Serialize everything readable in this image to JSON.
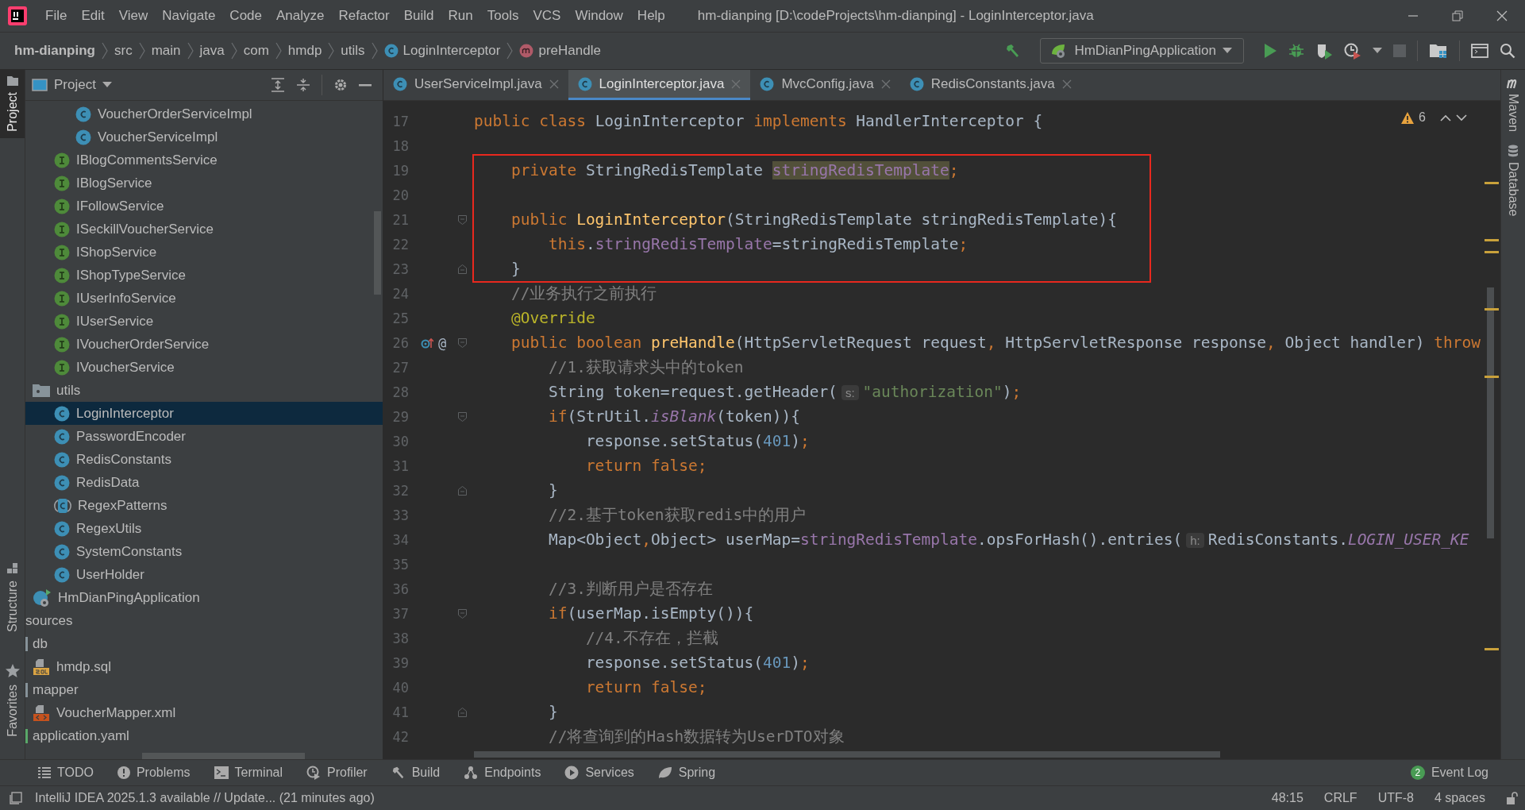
{
  "window": {
    "title": "hm-dianping [D:\\codeProjects\\hm-dianping] - LoginInterceptor.java"
  },
  "menu": [
    "File",
    "Edit",
    "View",
    "Navigate",
    "Code",
    "Analyze",
    "Refactor",
    "Build",
    "Run",
    "Tools",
    "VCS",
    "Window",
    "Help"
  ],
  "breadcrumb": [
    {
      "label": "hm-dianping",
      "kind": "project"
    },
    {
      "label": "src",
      "kind": "folder"
    },
    {
      "label": "main",
      "kind": "folder"
    },
    {
      "label": "java",
      "kind": "folder"
    },
    {
      "label": "com",
      "kind": "folder"
    },
    {
      "label": "hmdp",
      "kind": "folder"
    },
    {
      "label": "utils",
      "kind": "folder"
    },
    {
      "label": "LoginInterceptor",
      "kind": "class"
    },
    {
      "label": "preHandle",
      "kind": "method"
    }
  ],
  "run_config": {
    "label": "HmDianPingApplication"
  },
  "left_stripe": {
    "top": [
      {
        "label": "Project",
        "selected": true
      }
    ],
    "bottom": [
      {
        "label": "Structure",
        "selected": false
      },
      {
        "label": "Favorites",
        "selected": false
      }
    ]
  },
  "project_panel": {
    "title": "Project",
    "tree": [
      {
        "children": [
          {
            "children": [
              {
                "children": [
                  {
                    "children": [
                      {
                        "label": "VoucherOrderServiceImpl",
                        "kind": "class",
                        "selected": false
                      },
                      {
                        "label": "VoucherServiceImpl",
                        "kind": "class",
                        "selected": false
                      }
                    ]
                  },
                  {
                    "label": "IBlogCommentsService",
                    "kind": "interface",
                    "selected": false
                  },
                  {
                    "label": "IBlogService",
                    "kind": "interface",
                    "selected": false
                  },
                  {
                    "label": "IFollowService",
                    "kind": "interface",
                    "selected": false
                  },
                  {
                    "label": "ISeckillVoucherService",
                    "kind": "interface",
                    "selected": false
                  },
                  {
                    "label": "IShopService",
                    "kind": "interface",
                    "selected": false
                  },
                  {
                    "label": "IShopTypeService",
                    "kind": "interface",
                    "selected": false
                  },
                  {
                    "label": "IUserInfoService",
                    "kind": "interface",
                    "selected": false
                  },
                  {
                    "label": "IUserService",
                    "kind": "interface",
                    "selected": false
                  },
                  {
                    "label": "IVoucherOrderService",
                    "kind": "interface",
                    "selected": false
                  },
                  {
                    "label": "IVoucherService",
                    "kind": "interface",
                    "selected": false
                  }
                ]
              },
              {
                "label": "utils",
                "kind": "folder",
                "selected": false,
                "children": [
                  {
                    "label": "LoginInterceptor",
                    "kind": "class",
                    "selected": true
                  },
                  {
                    "label": "PasswordEncoder",
                    "kind": "class",
                    "selected": false
                  },
                  {
                    "label": "RedisConstants",
                    "kind": "class",
                    "selected": false
                  },
                  {
                    "label": "RedisData",
                    "kind": "class",
                    "selected": false
                  },
                  {
                    "label": "RegexPatterns",
                    "kind": "class-final",
                    "selected": false
                  },
                  {
                    "label": "RegexUtils",
                    "kind": "class",
                    "selected": false
                  },
                  {
                    "label": "SystemConstants",
                    "kind": "class",
                    "selected": false
                  },
                  {
                    "label": "UserHolder",
                    "kind": "class",
                    "selected": false
                  }
                ]
              },
              {
                "label": "HmDianPingApplication",
                "kind": "app",
                "selected": false
              }
            ]
          }
        ]
      },
      {
        "label": "sources",
        "selected": false,
        "children": [
          {
            "label": "db",
            "kind": "folder",
            "selected": false,
            "children": [
              {
                "label": "hmdp.sql",
                "kind": "sql",
                "selected": false
              }
            ]
          },
          {
            "label": "mapper",
            "kind": "folder",
            "selected": false,
            "children": [
              {
                "label": "VoucherMapper.xml",
                "kind": "xml",
                "selected": false
              }
            ]
          },
          {
            "label": "application.yaml",
            "kind": "yaml",
            "selected": false
          }
        ]
      }
    ]
  },
  "editor_tabs": [
    {
      "label": "UserServiceImpl.java",
      "selected": false
    },
    {
      "label": "LoginInterceptor.java",
      "selected": true
    },
    {
      "label": "MvcConfig.java",
      "selected": false
    },
    {
      "label": "RedisConstants.java",
      "selected": false
    }
  ],
  "editor": {
    "warnings": "6",
    "blocks": [
      {
        "boxed": false,
        "lines": [
          {
            "number": "17",
            "tokens": [
              {
                "kind": "keyword",
                "text": "public class "
              },
              {
                "kind": "plain",
                "text": "LoginInterceptor "
              },
              {
                "kind": "keyword",
                "text": "implements "
              },
              {
                "kind": "plain",
                "text": "HandlerInterceptor {"
              }
            ]
          },
          {
            "number": "18"
          }
        ]
      },
      {
        "boxed": true,
        "lines": [
          {
            "number": "19",
            "tokens": [
              {
                "kind": "keyword",
                "text": "    private "
              },
              {
                "kind": "plain",
                "text": "StringRedisTemplate "
              },
              {
                "kind": "field",
                "text": "stringRedisTemplate",
                "marked": true
              },
              {
                "kind": "keyword",
                "text": ";"
              }
            ]
          },
          {
            "number": "20"
          },
          {
            "number": "21",
            "fold_open": true,
            "tokens": [
              {
                "kind": "keyword",
                "text": "    public "
              },
              {
                "kind": "method",
                "text": "LoginInterceptor"
              },
              {
                "kind": "plain",
                "text": "(StringRedisTemplate stringRedisTemplate){"
              }
            ]
          },
          {
            "number": "22",
            "tokens": [
              {
                "kind": "keyword",
                "text": "        this"
              },
              {
                "kind": "plain",
                "text": "."
              },
              {
                "kind": "field",
                "text": "stringRedisTemplate"
              },
              {
                "kind": "plain",
                "text": "=stringRedisTemplate"
              },
              {
                "kind": "keyword",
                "text": ";"
              }
            ]
          },
          {
            "number": "23",
            "fold_close": true,
            "tokens": [
              {
                "kind": "plain",
                "text": "    }"
              }
            ]
          }
        ]
      },
      {
        "boxed": false,
        "lines": [
          {
            "number": "24",
            "tokens": [
              {
                "kind": "comment",
                "text": "    //业务执行之前执行"
              }
            ]
          },
          {
            "number": "25",
            "tokens": [
              {
                "kind": "annotation",
                "text": "    @Override"
              }
            ]
          },
          {
            "number": "26",
            "fold_open": true,
            "override_marker": true,
            "gutter_text": "@",
            "tokens": [
              {
                "kind": "keyword",
                "text": "    public boolean "
              },
              {
                "kind": "method",
                "text": "preHandle"
              },
              {
                "kind": "plain",
                "text": "(HttpServletRequest request"
              },
              {
                "kind": "keyword",
                "text": ", "
              },
              {
                "kind": "plain",
                "text": "HttpServletResponse response"
              },
              {
                "kind": "keyword",
                "text": ", "
              },
              {
                "kind": "plain",
                "text": "Object handler) "
              },
              {
                "kind": "keyword",
                "text": "throw"
              }
            ]
          },
          {
            "number": "27",
            "tokens": [
              {
                "kind": "comment",
                "text": "        //1.获取请求头中的token"
              }
            ]
          },
          {
            "number": "28",
            "tokens": [
              {
                "kind": "plain",
                "text": "        String token=request.getHeader("
              },
              {
                "kind": "hint",
                "text": "s:"
              },
              {
                "kind": "string",
                "text": "\"authorization\""
              },
              {
                "kind": "plain",
                "text": ")"
              },
              {
                "kind": "keyword",
                "text": ";"
              }
            ]
          },
          {
            "number": "29",
            "fold_open": true,
            "tokens": [
              {
                "kind": "keyword",
                "text": "        if"
              },
              {
                "kind": "plain",
                "text": "(StrUtil."
              },
              {
                "kind": "static",
                "text": "isBlank"
              },
              {
                "kind": "plain",
                "text": "(token)){"
              }
            ]
          },
          {
            "number": "30",
            "tokens": [
              {
                "kind": "plain",
                "text": "            response.setStatus("
              },
              {
                "kind": "number",
                "text": "401"
              },
              {
                "kind": "plain",
                "text": ")"
              },
              {
                "kind": "keyword",
                "text": ";"
              }
            ]
          },
          {
            "number": "31",
            "tokens": [
              {
                "kind": "keyword",
                "text": "            return false;"
              }
            ]
          },
          {
            "number": "32",
            "fold_close": true,
            "tokens": [
              {
                "kind": "plain",
                "text": "        }"
              }
            ]
          },
          {
            "number": "33",
            "tokens": [
              {
                "kind": "comment",
                "text": "        //2.基于token获取redis中的用户"
              }
            ]
          },
          {
            "number": "34",
            "tokens": [
              {
                "kind": "plain",
                "text": "        Map<Object"
              },
              {
                "kind": "keyword",
                "text": ","
              },
              {
                "kind": "plain",
                "text": "Object> userMap="
              },
              {
                "kind": "field",
                "text": "stringRedisTemplate"
              },
              {
                "kind": "plain",
                "text": ".opsForHash().entries("
              },
              {
                "kind": "hint",
                "text": "h:"
              },
              {
                "kind": "plain",
                "text": "RedisConstants."
              },
              {
                "kind": "static",
                "text": "LOGIN_USER_KE"
              }
            ]
          },
          {
            "number": "35"
          },
          {
            "number": "36",
            "tokens": [
              {
                "kind": "comment",
                "text": "        //3.判断用户是否存在"
              }
            ]
          },
          {
            "number": "37",
            "fold_open": true,
            "tokens": [
              {
                "kind": "keyword",
                "text": "        if"
              },
              {
                "kind": "plain",
                "text": "(userMap.isEmpty()){"
              }
            ]
          },
          {
            "number": "38",
            "tokens": [
              {
                "kind": "comment",
                "text": "            //4.不存在，拦截"
              }
            ]
          },
          {
            "number": "39",
            "tokens": [
              {
                "kind": "plain",
                "text": "            response.setStatus("
              },
              {
                "kind": "number",
                "text": "401"
              },
              {
                "kind": "plain",
                "text": ")"
              },
              {
                "kind": "keyword",
                "text": ";"
              }
            ]
          },
          {
            "number": "40",
            "tokens": [
              {
                "kind": "keyword",
                "text": "            return false;"
              }
            ]
          },
          {
            "number": "41",
            "fold_close": true,
            "tokens": [
              {
                "kind": "plain",
                "text": "        }"
              }
            ]
          },
          {
            "number": "42",
            "tokens": [
              {
                "kind": "comment",
                "text": "        //将查询到的Hash数据转为UserDTO对象"
              }
            ]
          }
        ]
      }
    ]
  },
  "right_stripe": [
    {
      "label": "Maven"
    },
    {
      "label": "Database"
    }
  ],
  "tool_windows": [
    {
      "label": "TODO"
    },
    {
      "label": "Problems"
    },
    {
      "label": "Terminal"
    },
    {
      "label": "Profiler"
    },
    {
      "label": "Build"
    },
    {
      "label": "Endpoints"
    },
    {
      "label": "Services"
    },
    {
      "label": "Spring"
    }
  ],
  "event_log": {
    "label": "Event Log",
    "badge": "2"
  },
  "status_bar": {
    "message": "IntelliJ IDEA 2025.1.3 available // Update... (21 minutes ago)",
    "items": [
      "48:15",
      "CRLF",
      "UTF-8",
      "4 spaces"
    ]
  }
}
